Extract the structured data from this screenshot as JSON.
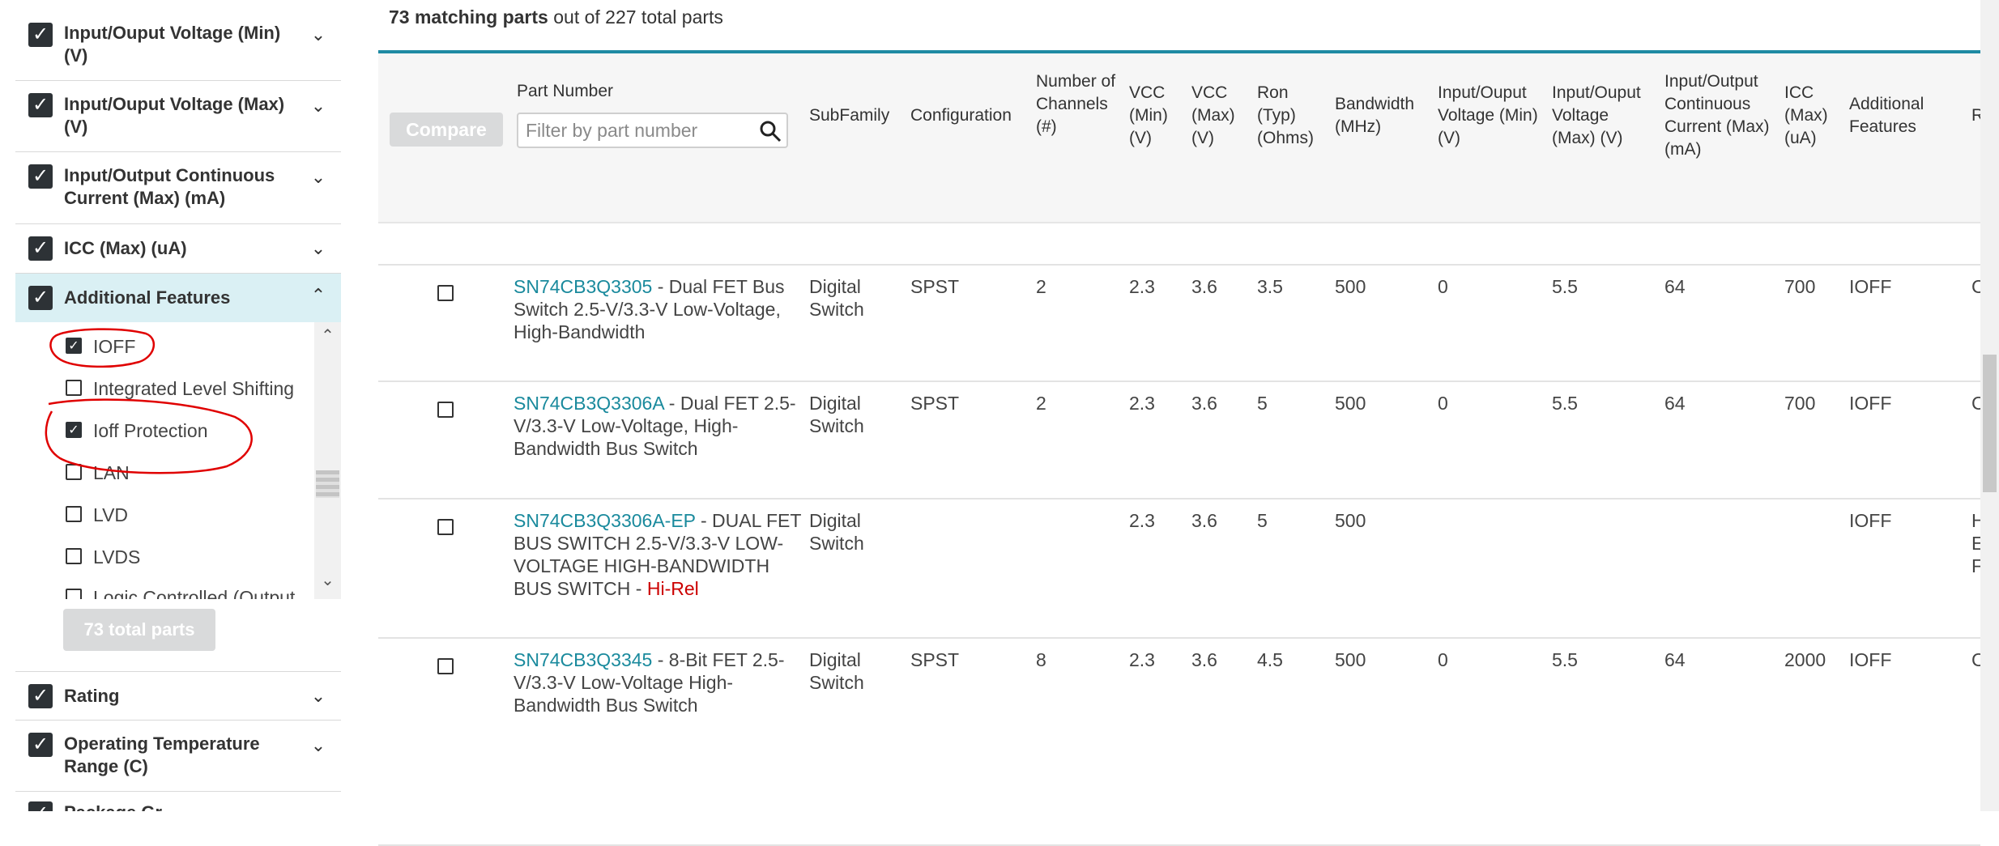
{
  "sidebar": {
    "facets": [
      {
        "label": "Input/Ouput Voltage (Min) (V)",
        "chevron": "chevron-down-icon"
      },
      {
        "label": "Input/Ouput Voltage (Max) (V)",
        "chevron": "chevron-down-icon"
      },
      {
        "label": "Input/Output Continuous Current (Max) (mA)",
        "chevron": "chevron-down-icon"
      },
      {
        "label": "ICC (Max) (uA)",
        "chevron": "chevron-down-icon"
      },
      {
        "label": "Additional Features",
        "chevron": "chevron-up-icon"
      }
    ],
    "feature_options": [
      {
        "label": "IOFF",
        "checked": true
      },
      {
        "label": "Integrated Level Shifting",
        "checked": false
      },
      {
        "label": "Ioff Protection",
        "checked": true
      },
      {
        "label": "LAN",
        "checked": false
      },
      {
        "label": "LVD",
        "checked": false
      },
      {
        "label": "LVDS",
        "checked": false
      },
      {
        "label": "Logic Controlled (Output",
        "checked": false
      }
    ],
    "total_parts_button": "73 total parts",
    "facets_below": [
      {
        "label": "Rating",
        "chevron": "chevron-down-icon"
      },
      {
        "label": "Operating Temperature Range (C)",
        "chevron": "chevron-down-icon"
      },
      {
        "label": "Package Gr",
        "chevron": "chevron-down-icon"
      }
    ]
  },
  "summary": {
    "count": "73 matching parts",
    "rest": "out of 227 total parts"
  },
  "table": {
    "compare_button": "Compare",
    "part_number_header": "Part Number",
    "filter_placeholder": "Filter by part number",
    "headers": [
      "SubFamily",
      "Configuration",
      "Number of Channels (#)",
      "VCC (Min) (V)",
      "VCC (Max) (V)",
      "Ron (Typ) (Ohms)",
      "Bandwidth (MHz)",
      "Input/Ouput Voltage (Min) (V)",
      "Input/Ouput Voltage (Max) (V)",
      "Input/Output Continuous Current (Max) (mA)",
      "ICC (Max) (uA)",
      "Additional Features",
      "R"
    ],
    "rows": [
      {
        "part": "SN74CB3Q3305",
        "desc": " - Dual FET Bus Switch 2.5-V/3.3-V Low-Voltage, High-Bandwidth",
        "hirel": "",
        "subfamily": "Digital Switch",
        "config": "SPST",
        "channels": "2",
        "vcc_min": "2.3",
        "vcc_max": "3.6",
        "ron": "3.5",
        "bandwidth": "500",
        "io_min": "0",
        "io_max": "5.5",
        "current": "64",
        "icc": "700",
        "features": "IOFF",
        "extra": "C"
      },
      {
        "part": "SN74CB3Q3306A",
        "desc": " - Dual FET 2.5-V/3.3-V Low-Voltage, High-Bandwidth Bus Switch",
        "hirel": "",
        "subfamily": "Digital Switch",
        "config": "SPST",
        "channels": "2",
        "vcc_min": "2.3",
        "vcc_max": "3.6",
        "ron": "5",
        "bandwidth": "500",
        "io_min": "0",
        "io_max": "5.5",
        "current": "64",
        "icc": "700",
        "features": "IOFF",
        "extra": "C"
      },
      {
        "part": "SN74CB3Q3306A-EP",
        "desc": " - DUAL FET BUS SWITCH 2.5-V/3.3-V LOW-VOLTAGE HIGH-BANDWIDTH BUS SWITCH - ",
        "hirel": "Hi-Rel",
        "subfamily": "Digital Switch",
        "config": "",
        "channels": "",
        "vcc_min": "2.3",
        "vcc_max": "3.6",
        "ron": "5",
        "bandwidth": "500",
        "io_min": "",
        "io_max": "",
        "current": "",
        "icc": "",
        "features": "IOFF",
        "extra": "H E F"
      },
      {
        "part": "SN74CB3Q3345",
        "desc": " - 8-Bit FET 2.5-V/3.3-V Low-Voltage High-Bandwidth Bus Switch",
        "hirel": "",
        "subfamily": "Digital Switch",
        "config": "SPST",
        "channels": "8",
        "vcc_min": "2.3",
        "vcc_max": "3.6",
        "ron": "4.5",
        "bandwidth": "500",
        "io_min": "0",
        "io_max": "5.5",
        "current": "64",
        "icc": "2000",
        "features": "IOFF",
        "extra": "C"
      }
    ]
  },
  "colors": {
    "link": "#1a8a9d",
    "accent_bar": "#1e8aa3",
    "hirel": "#cc0000",
    "annotation": "#e00000"
  }
}
